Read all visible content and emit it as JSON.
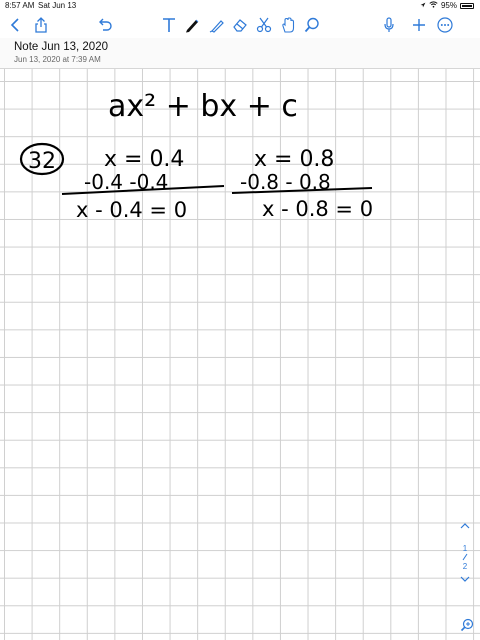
{
  "status_bar": {
    "time": "8:57 AM",
    "date": "Sat Jun 13",
    "battery": "95%",
    "icons": [
      "wifi-icon",
      "location-icon",
      "battery-icon"
    ]
  },
  "toolbar": {
    "left_tools": [
      "back-icon",
      "share-icon",
      "undo-icon"
    ],
    "center_tools": [
      "text-tool-icon",
      "pen-icon",
      "eraser-icon",
      "scissors-icon",
      "hand-icon",
      "search-icon"
    ],
    "right_tools": [
      "mic-icon",
      "add-icon",
      "more-icon"
    ],
    "accent_color": "#2f7ad8"
  },
  "note": {
    "title": "Note Jun 13, 2020",
    "subtitle": "Jun 13, 2020 at 7:39 AM"
  },
  "handwriting": {
    "top_expression": "ax² + bx + c",
    "problem_number": "32",
    "left_equation_top": "x = 0.4",
    "left_equation_sub": "-0.4 -0.4",
    "left_equation_result": "x - 0.4 = 0",
    "right_equation_top": "x = 0.8",
    "right_equation_sub": "-0.8 - 0.8",
    "right_equation_result": "x - 0.8 = 0"
  },
  "page_nav": {
    "current_page": "1",
    "total_pages": "2",
    "up_icon": "chevron-up-icon",
    "down_icon": "chevron-down-icon",
    "zoom_icon": "zoom-icon"
  }
}
